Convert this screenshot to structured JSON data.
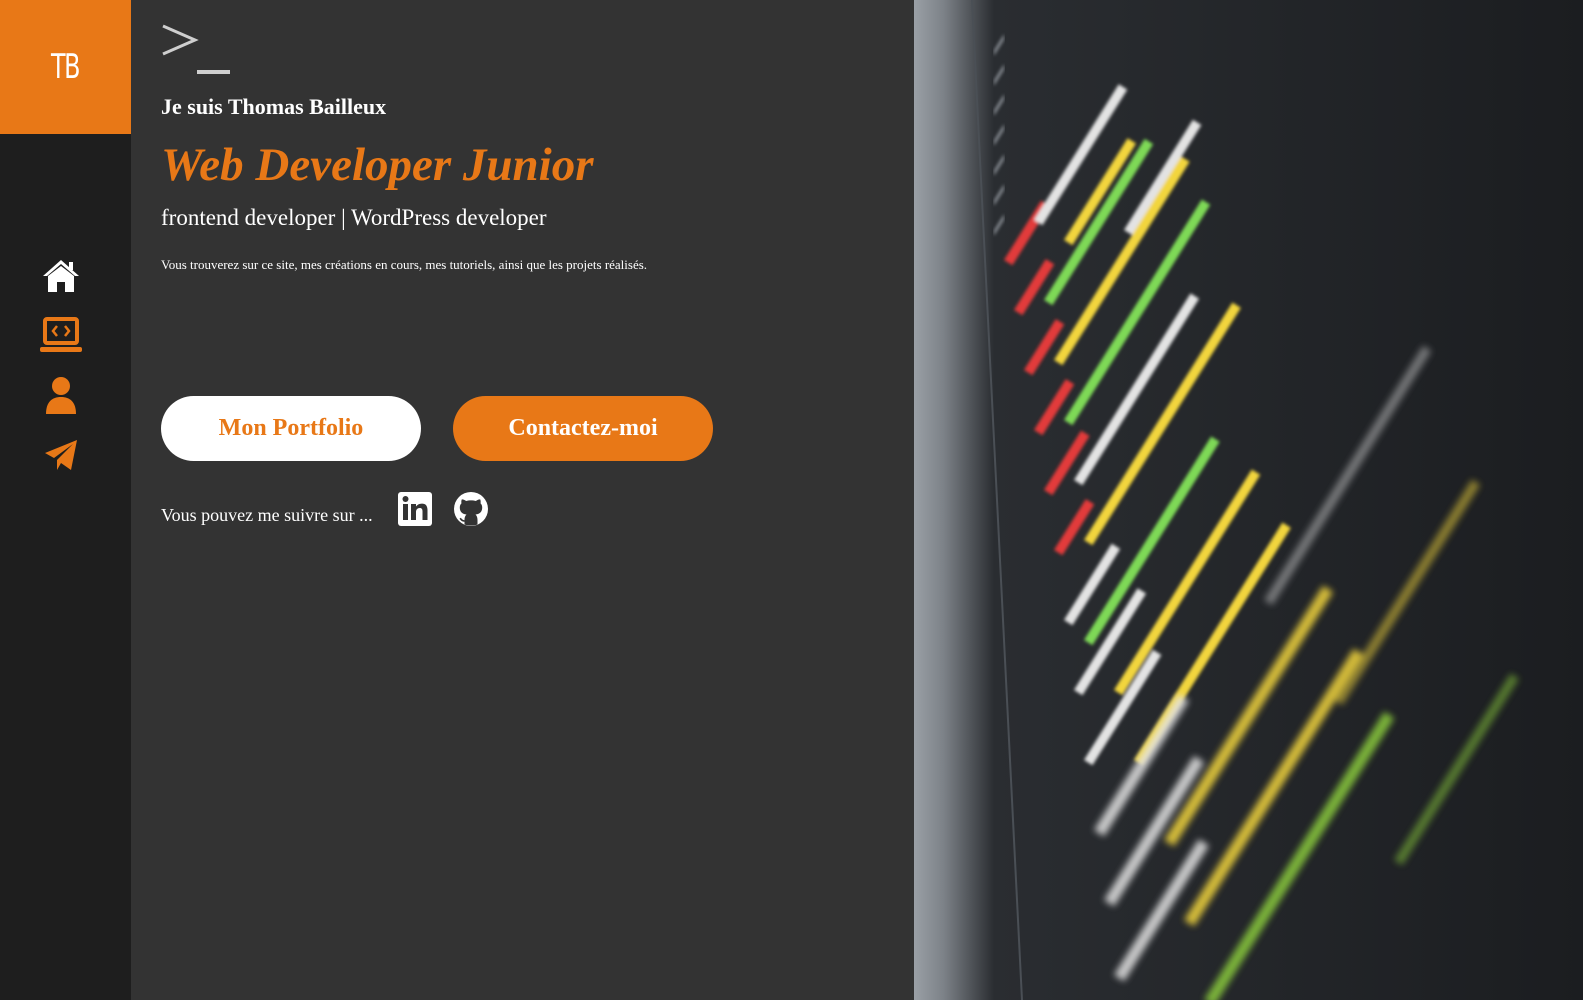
{
  "sidebar": {
    "logo_text": "TB",
    "accent_color": "#e87817",
    "items": [
      {
        "icon": "home-icon",
        "active": true
      },
      {
        "icon": "laptop-code-icon",
        "active": false
      },
      {
        "icon": "user-icon",
        "active": false
      },
      {
        "icon": "paper-plane-icon",
        "active": false
      }
    ]
  },
  "hero": {
    "prompt_icon": "terminal-prompt-icon",
    "greeting": "Je suis Thomas Bailleux",
    "job_title": "Web Developer Junior",
    "subtitle": "frontend developer | WordPress developer",
    "description": "Vous trouverez sur ce site, mes créations en cours, mes tutoriels, ainsi que les projets réalisés.",
    "buttons": {
      "portfolio_label": "Mon Portfolio",
      "contact_label": "Contactez-moi"
    },
    "follow_text": "Vous pouvez me suivre sur ...",
    "social": [
      {
        "icon": "linkedin-icon"
      },
      {
        "icon": "github-icon"
      }
    ]
  },
  "background_image": {
    "subject": "code-editor-photo"
  }
}
